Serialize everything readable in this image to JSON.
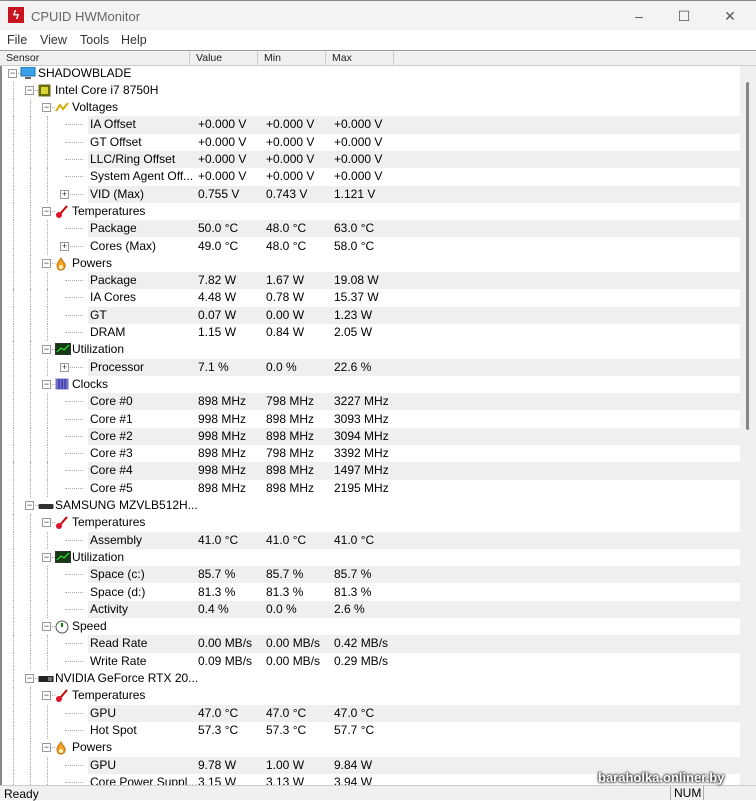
{
  "window": {
    "title": "CPUID HWMonitor",
    "minimize": "–",
    "maximize": "☐",
    "close": "✕"
  },
  "menu": [
    "File",
    "View",
    "Tools",
    "Help"
  ],
  "columns": [
    "Sensor",
    "Value",
    "Min",
    "Max"
  ],
  "rows": [
    {
      "d": 0,
      "e": "-",
      "icon": "computer",
      "name": "SHADOWBLADE"
    },
    {
      "d": 1,
      "e": "-",
      "icon": "cpu",
      "name": "Intel Core i7 8750H"
    },
    {
      "d": 2,
      "e": "-",
      "icon": "voltage",
      "name": "Voltages"
    },
    {
      "d": 3,
      "name": "IA Offset",
      "v": [
        "+0.000 V",
        "+0.000 V",
        "+0.000 V"
      ]
    },
    {
      "d": 3,
      "name": "GT Offset",
      "v": [
        "+0.000 V",
        "+0.000 V",
        "+0.000 V"
      ]
    },
    {
      "d": 3,
      "name": "LLC/Ring Offset",
      "v": [
        "+0.000 V",
        "+0.000 V",
        "+0.000 V"
      ]
    },
    {
      "d": 3,
      "name": "System Agent Off...",
      "v": [
        "+0.000 V",
        "+0.000 V",
        "+0.000 V"
      ]
    },
    {
      "d": 3,
      "e": "+",
      "name": "VID (Max)",
      "v": [
        "0.755 V",
        "0.743 V",
        "1.121 V"
      ]
    },
    {
      "d": 2,
      "e": "-",
      "icon": "temperature",
      "name": "Temperatures"
    },
    {
      "d": 3,
      "name": "Package",
      "v": [
        "50.0 °C",
        "48.0 °C",
        "63.0 °C"
      ]
    },
    {
      "d": 3,
      "e": "+",
      "name": "Cores (Max)",
      "v": [
        "49.0 °C",
        "48.0 °C",
        "58.0 °C"
      ]
    },
    {
      "d": 2,
      "e": "-",
      "icon": "power",
      "name": "Powers"
    },
    {
      "d": 3,
      "name": "Package",
      "v": [
        "7.82 W",
        "1.67 W",
        "19.08 W"
      ]
    },
    {
      "d": 3,
      "name": "IA Cores",
      "v": [
        "4.48 W",
        "0.78 W",
        "15.37 W"
      ]
    },
    {
      "d": 3,
      "name": "GT",
      "v": [
        "0.07 W",
        "0.00 W",
        "1.23 W"
      ]
    },
    {
      "d": 3,
      "name": "DRAM",
      "v": [
        "1.15 W",
        "0.84 W",
        "2.05 W"
      ]
    },
    {
      "d": 2,
      "e": "-",
      "icon": "utilization",
      "name": "Utilization"
    },
    {
      "d": 3,
      "e": "+",
      "name": "Processor",
      "v": [
        "7.1 %",
        "0.0 %",
        "22.6 %"
      ]
    },
    {
      "d": 2,
      "e": "-",
      "icon": "clocks",
      "name": "Clocks"
    },
    {
      "d": 3,
      "name": "Core #0",
      "v": [
        "898 MHz",
        "798 MHz",
        "3227 MHz"
      ]
    },
    {
      "d": 3,
      "name": "Core #1",
      "v": [
        "998 MHz",
        "898 MHz",
        "3093 MHz"
      ]
    },
    {
      "d": 3,
      "name": "Core #2",
      "v": [
        "998 MHz",
        "898 MHz",
        "3094 MHz"
      ]
    },
    {
      "d": 3,
      "name": "Core #3",
      "v": [
        "898 MHz",
        "798 MHz",
        "3392 MHz"
      ]
    },
    {
      "d": 3,
      "name": "Core #4",
      "v": [
        "998 MHz",
        "898 MHz",
        "1497 MHz"
      ]
    },
    {
      "d": 3,
      "name": "Core #5",
      "v": [
        "898 MHz",
        "898 MHz",
        "2195 MHz"
      ]
    },
    {
      "d": 1,
      "e": "-",
      "icon": "drive",
      "name": "SAMSUNG MZVLB512H..."
    },
    {
      "d": 2,
      "e": "-",
      "icon": "temperature",
      "name": "Temperatures"
    },
    {
      "d": 3,
      "name": "Assembly",
      "v": [
        "41.0 °C",
        "41.0 °C",
        "41.0 °C"
      ]
    },
    {
      "d": 2,
      "e": "-",
      "icon": "utilization",
      "name": "Utilization"
    },
    {
      "d": 3,
      "name": "Space (c:)",
      "v": [
        "85.7 %",
        "85.7 %",
        "85.7 %"
      ]
    },
    {
      "d": 3,
      "name": "Space (d:)",
      "v": [
        "81.3 %",
        "81.3 %",
        "81.3 %"
      ]
    },
    {
      "d": 3,
      "name": "Activity",
      "v": [
        "0.4 %",
        "0.0 %",
        "2.6 %"
      ]
    },
    {
      "d": 2,
      "e": "-",
      "icon": "speed",
      "name": "Speed"
    },
    {
      "d": 3,
      "name": "Read Rate",
      "v": [
        "0.00 MB/s",
        "0.00 MB/s",
        "0.42 MB/s"
      ]
    },
    {
      "d": 3,
      "name": "Write Rate",
      "v": [
        "0.09 MB/s",
        "0.00 MB/s",
        "0.29 MB/s"
      ]
    },
    {
      "d": 1,
      "e": "-",
      "icon": "gpu",
      "name": "NVIDIA GeForce RTX 20..."
    },
    {
      "d": 2,
      "e": "-",
      "icon": "temperature",
      "name": "Temperatures"
    },
    {
      "d": 3,
      "name": "GPU",
      "v": [
        "47.0 °C",
        "47.0 °C",
        "47.0 °C"
      ]
    },
    {
      "d": 3,
      "name": "Hot Spot",
      "v": [
        "57.3 °C",
        "57.3 °C",
        "57.7 °C"
      ]
    },
    {
      "d": 2,
      "e": "-",
      "icon": "power",
      "name": "Powers"
    },
    {
      "d": 3,
      "name": "GPU",
      "v": [
        "9.78 W",
        "1.00 W",
        "9.84 W"
      ]
    },
    {
      "d": 3,
      "name": "Core Power Suppl...",
      "v": [
        "3.15 W",
        "3.13 W",
        "3.94 W"
      ]
    }
  ],
  "status": {
    "text": "Ready",
    "num": "NUM"
  },
  "watermark": "baraholka.onliner.by"
}
